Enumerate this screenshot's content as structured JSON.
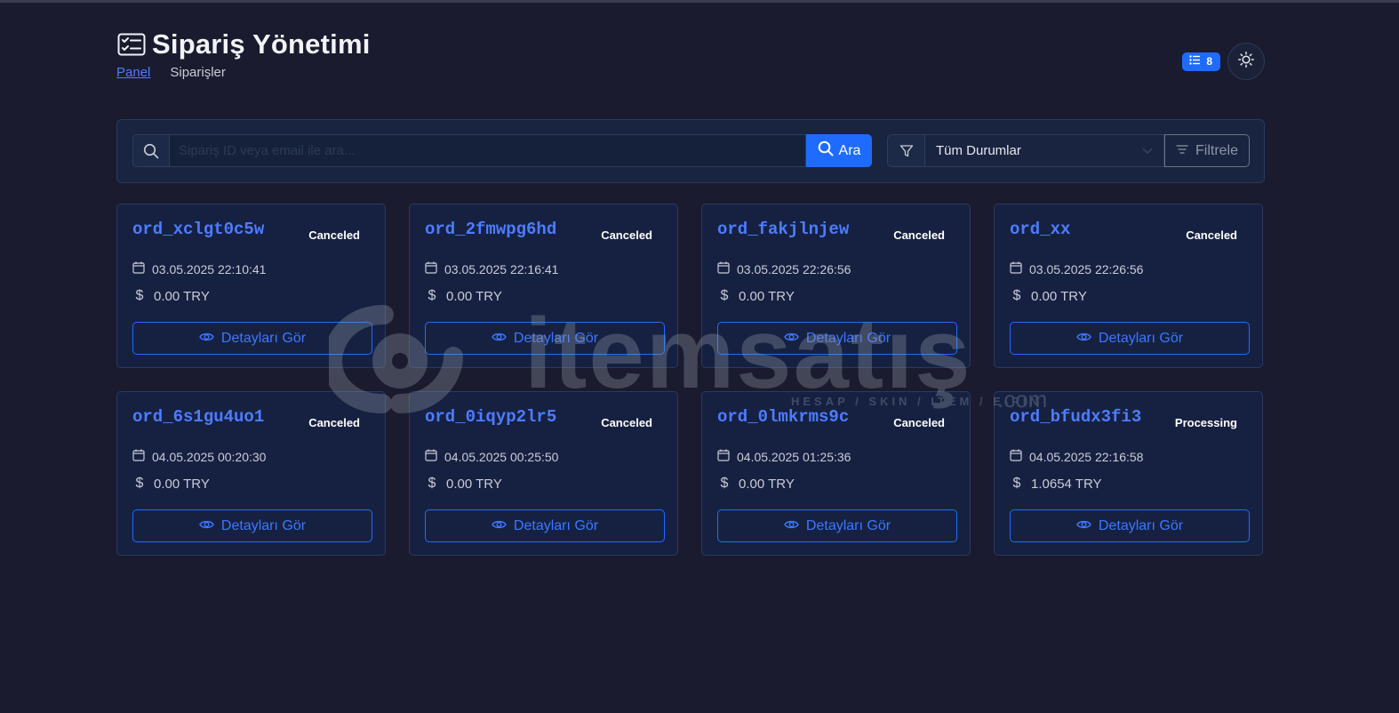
{
  "header": {
    "title": "Sipariş Yönetimi",
    "breadcrumb": {
      "home": "Panel",
      "current": "Siparişler"
    },
    "order_count": "8"
  },
  "search": {
    "placeholder": "Sipariş ID veya email ile ara...",
    "value": "",
    "button_label": "Ara"
  },
  "filter": {
    "selected_status": "Tüm Durumlar",
    "button_label": "Filtrele"
  },
  "detail_button_label": "Detayları Gör",
  "orders": [
    {
      "id": "ord_xclgt0c5w",
      "status": "Canceled",
      "date": "03.05.2025 22:10:41",
      "amount": "0.00 TRY"
    },
    {
      "id": "ord_2fmwpg6hd",
      "status": "Canceled",
      "date": "03.05.2025 22:16:41",
      "amount": "0.00 TRY"
    },
    {
      "id": "ord_fakjlnjew",
      "status": "Canceled",
      "date": "03.05.2025 22:26:56",
      "amount": "0.00 TRY"
    },
    {
      "id": "ord_xx",
      "status": "Canceled",
      "date": "03.05.2025 22:26:56",
      "amount": "0.00 TRY"
    },
    {
      "id": "ord_6s1gu4uo1",
      "status": "Canceled",
      "date": "04.05.2025 00:20:30",
      "amount": "0.00 TRY"
    },
    {
      "id": "ord_0iqyp2lr5",
      "status": "Canceled",
      "date": "04.05.2025 00:25:50",
      "amount": "0.00 TRY"
    },
    {
      "id": "ord_0lmkrms9c",
      "status": "Canceled",
      "date": "04.05.2025 01:25:36",
      "amount": "0.00 TRY"
    },
    {
      "id": "ord_bfudx3fi3",
      "status": "Processing",
      "date": "04.05.2025 22:16:58",
      "amount": "1.0654 TRY"
    }
  ],
  "watermark": {
    "brand": "itemsatış",
    "tagline": "HESAP / SKIN / ITEM / E-PIN",
    "suffix": ".com"
  },
  "colors": {
    "background": "#1a1b2e",
    "card": "#162142",
    "accent": "#1f6bff",
    "order_id": "#4d7cff"
  },
  "icons": {
    "title": "checklist-icon",
    "search": "search-icon",
    "filter": "funnel-icon",
    "date": "calendar-icon",
    "amount": "dollar-icon",
    "detail": "eye-icon",
    "theme": "sun-icon"
  }
}
